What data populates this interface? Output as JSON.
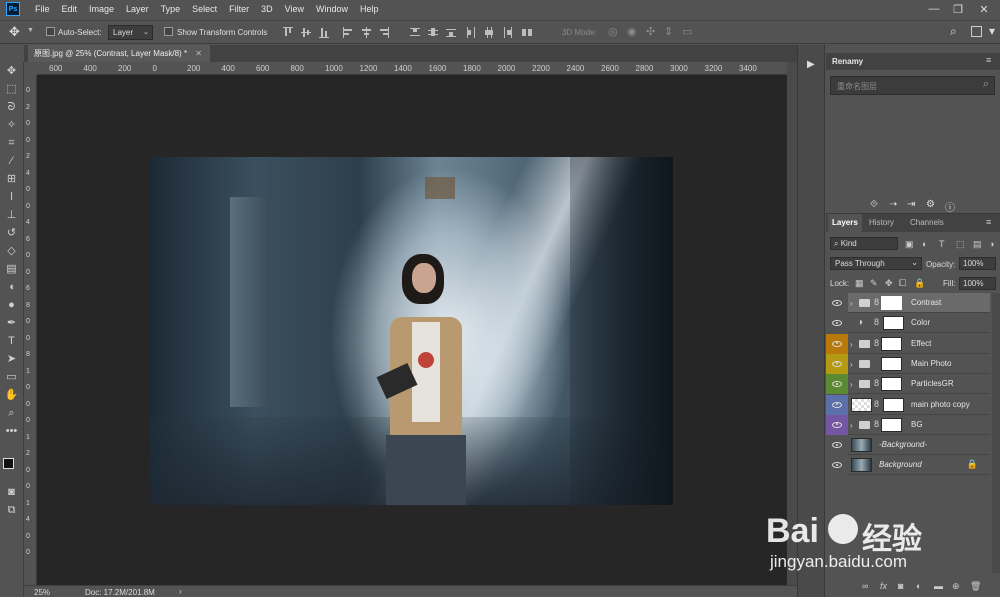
{
  "menubar": {
    "logo": "Ps",
    "items": [
      "File",
      "Edit",
      "Image",
      "Layer",
      "Type",
      "Select",
      "Filter",
      "3D",
      "View",
      "Window",
      "Help"
    ],
    "window_controls": [
      "—",
      "❐",
      "✕"
    ]
  },
  "options_bar": {
    "auto_select_label": "Auto-Select:",
    "auto_select_value": "Layer",
    "show_transform_label": "Show Transform Controls",
    "mode_3d_label": "3D Mode:"
  },
  "document": {
    "tab_title": "原图.jpg @ 25% (Contrast, Layer Mask/8) *",
    "ruler_top": [
      "600",
      "400",
      "200",
      "0",
      "200",
      "400",
      "600",
      "800",
      "1000",
      "1200",
      "1400",
      "1600",
      "1800",
      "2000",
      "2200",
      "2400",
      "2600",
      "2800",
      "3000",
      "3200",
      "3400"
    ],
    "ruler_left": [
      "0",
      "2",
      "0",
      "0",
      "2",
      "4",
      "0",
      "0",
      "4",
      "6",
      "0",
      "0",
      "6",
      "8",
      "0",
      "0",
      "8",
      "1",
      "0",
      "0",
      "0",
      "1",
      "2",
      "0",
      "0",
      "1",
      "4",
      "0",
      "0"
    ],
    "zoom": "25%",
    "doc_size": "Doc: 17.2M/201.8M"
  },
  "panels": {
    "renamy_title": "Renamy",
    "renamy_placeholder": "重命名图层",
    "tabs": [
      "Layers",
      "History",
      "Channels"
    ],
    "kind_label": "Kind",
    "blend_mode": "Pass Through",
    "opacity_label": "Opacity:",
    "opacity_value": "100%",
    "lock_label": "Lock:",
    "fill_label": "Fill:",
    "fill_value": "100%"
  },
  "layers": [
    {
      "name": "Contrast",
      "type": "group-mask",
      "selected": true,
      "color": "#535353"
    },
    {
      "name": "Color",
      "type": "adjustment",
      "selected": false,
      "color": "#535353"
    },
    {
      "name": "Effect",
      "type": "group",
      "selected": false,
      "color": "#b8790b"
    },
    {
      "name": "Main Photo",
      "type": "group-nomask",
      "selected": false,
      "color": "#b49a12"
    },
    {
      "name": "ParticlesGR",
      "type": "group",
      "selected": false,
      "color": "#5c8a32"
    },
    {
      "name": "main photo copy",
      "type": "photo",
      "selected": false,
      "color": "#5b6fa8"
    },
    {
      "name": "BG",
      "type": "group",
      "selected": false,
      "color": "#7556a2"
    },
    {
      "name": "-Background-",
      "type": "photo-only",
      "selected": false,
      "color": "#535353"
    },
    {
      "name": "Background",
      "type": "photo-locked",
      "selected": false,
      "color": "#535353"
    }
  ],
  "watermark": {
    "brand": "Bai",
    "brand2": "经验",
    "url": "jingyan.baidu.com"
  }
}
